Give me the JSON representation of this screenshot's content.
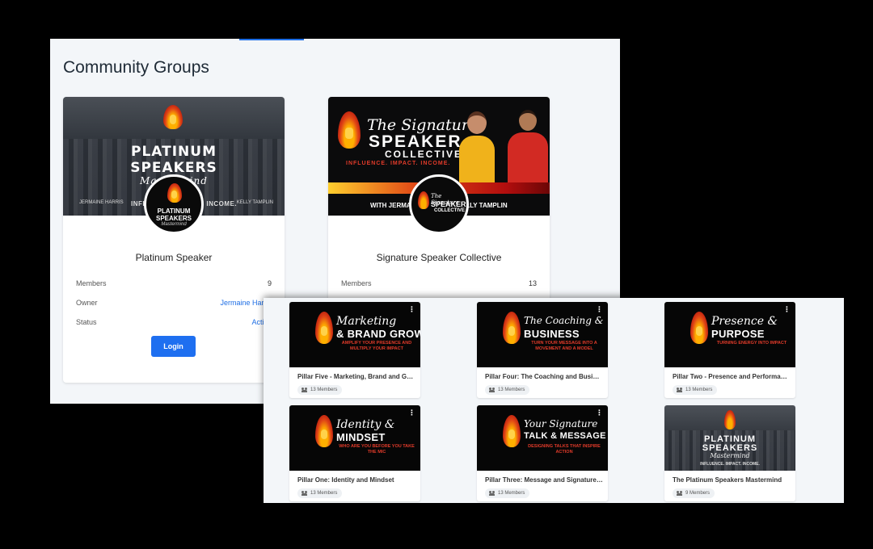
{
  "page_title": "Community Groups",
  "cards": [
    {
      "cover": {
        "line1": "PLATINUM",
        "line2": "SPEAKERS",
        "line3": "Mastermind",
        "left_caption": "JERMAINE HARRIS",
        "center_caption": "INFLUENCE. IMPACT. INCOME.",
        "right_caption": "KELLY TAMPLIN"
      },
      "avatar": {
        "line1": "PLATINUM",
        "line2": "SPEAKERS",
        "line3": "Mastermind"
      },
      "name": "Platinum Speaker",
      "members_label": "Members",
      "members_value": "9",
      "owner_label": "Owner",
      "owner_value": "Jermaine Harris",
      "status_label": "Status",
      "status_value": "Active",
      "login_label": "Login"
    },
    {
      "cover": {
        "title": "The Signature",
        "speaker": "SPEAKER",
        "collective": "COLLECTIVE",
        "tagline": "INFLUENCE. IMPACT. INCOME.",
        "footer": "WITH JERMAINE HARRIS & KELLY TAMPLIN"
      },
      "name": "Signature Speaker Collective",
      "members_label": "Members",
      "members_value": "13"
    }
  ],
  "tiles": [
    {
      "cover_l1": "Marketing",
      "cover_l2": "& BRAND GROWTH",
      "cover_l3": "AMPLIFY YOUR PRESENCE AND MULTIPLY YOUR IMPACT",
      "name": "Pillar Five - Marketing, Brand and Growth",
      "members": "13 Members"
    },
    {
      "cover_l1": "The Coaching &",
      "cover_l2": "BUSINESS",
      "cover_l3": "TURN YOUR MESSAGE INTO A MOVEMENT AND A MODEL",
      "name": "Pillar Four: The Coaching and Business Foundations",
      "members": "13 Members"
    },
    {
      "cover_l1": "Presence &",
      "cover_l2": "PURPOSE",
      "cover_l3": "TURNING ENERGY INTO IMPACT",
      "name": "Pillar Two - Presence and Performance",
      "members": "13 Members"
    },
    {
      "cover_l1": "Identity &",
      "cover_l2": "MINDSET",
      "cover_l3": "WHO ARE YOU BEFORE YOU TAKE THE MIC",
      "name": "Pillar One: Identity and Mindset",
      "members": "13 Members"
    },
    {
      "cover_l1": "Your Signature",
      "cover_l2": "TALK & MESSAGE",
      "cover_l3": "DESIGNING TALKS THAT INSPIRE ACTION",
      "name": "Pillar Three: Message and Signature Talk",
      "members": "13 Members"
    },
    {
      "cover_l1": "PLATINUM",
      "cover_l2": "SPEAKERS",
      "cover_l3": "Mastermind",
      "cover_l4": "INFLUENCE. IMPACT. INCOME.",
      "name": "The Platinum Speakers Mastermind",
      "members": "9 Members"
    }
  ],
  "colors": {
    "accent": "#1e6ff0",
    "link": "#1f6fe5",
    "panel_bg": "#f3f6f9"
  },
  "icons": {
    "tile_menu": "more-vert-icon",
    "members_chip": "people-icon",
    "logo": "flame-mic-icon"
  }
}
